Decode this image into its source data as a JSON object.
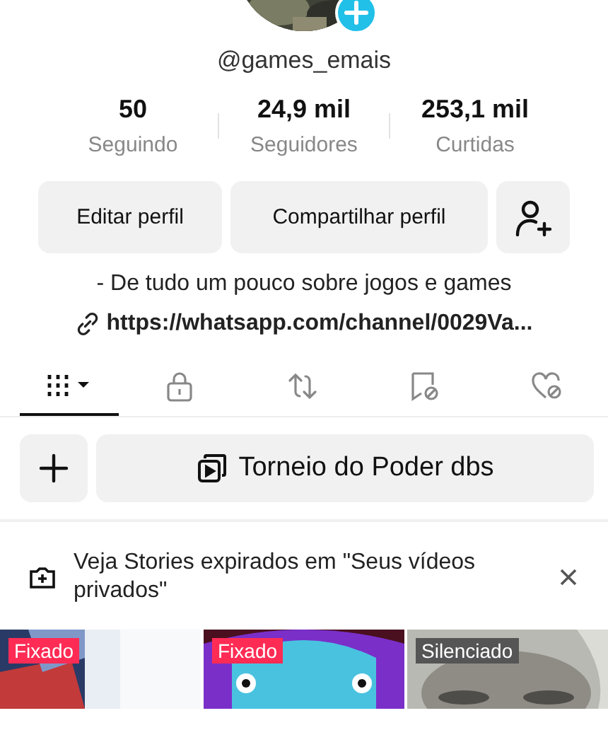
{
  "profile": {
    "username": "@games_emais",
    "stats": [
      {
        "value": "50",
        "label": "Seguindo"
      },
      {
        "value": "24,9 mil",
        "label": "Seguidores"
      },
      {
        "value": "253,1 mil",
        "label": "Curtidas"
      }
    ],
    "buttons": [
      "Editar perfil",
      "Compartilhar perfil"
    ],
    "bio": "- De tudo um pouco sobre jogos e games",
    "link": "https://whatsapp.com/channel/0029Va..."
  },
  "tabs": [
    {
      "kind": "grid",
      "selected": true
    },
    {
      "kind": "lock",
      "selected": false
    },
    {
      "kind": "repost",
      "selected": false
    },
    {
      "kind": "bookmark",
      "selected": false
    },
    {
      "kind": "heart",
      "selected": false
    }
  ],
  "playlist": {
    "title": "Torneio do Poder dbs"
  },
  "notice": {
    "text": "Veja Stories expirados em \"Seus vídeos privados\""
  },
  "videos": [
    {
      "kind": "picture",
      "badge": {
        "kind": "pinned",
        "label": "Fixado"
      }
    },
    {
      "kind": "picture",
      "badge": {
        "kind": "pinned",
        "label": "Fixado"
      }
    },
    {
      "kind": "picture",
      "badge": {
        "kind": "muted",
        "label": "Silenciado"
      }
    }
  ]
}
